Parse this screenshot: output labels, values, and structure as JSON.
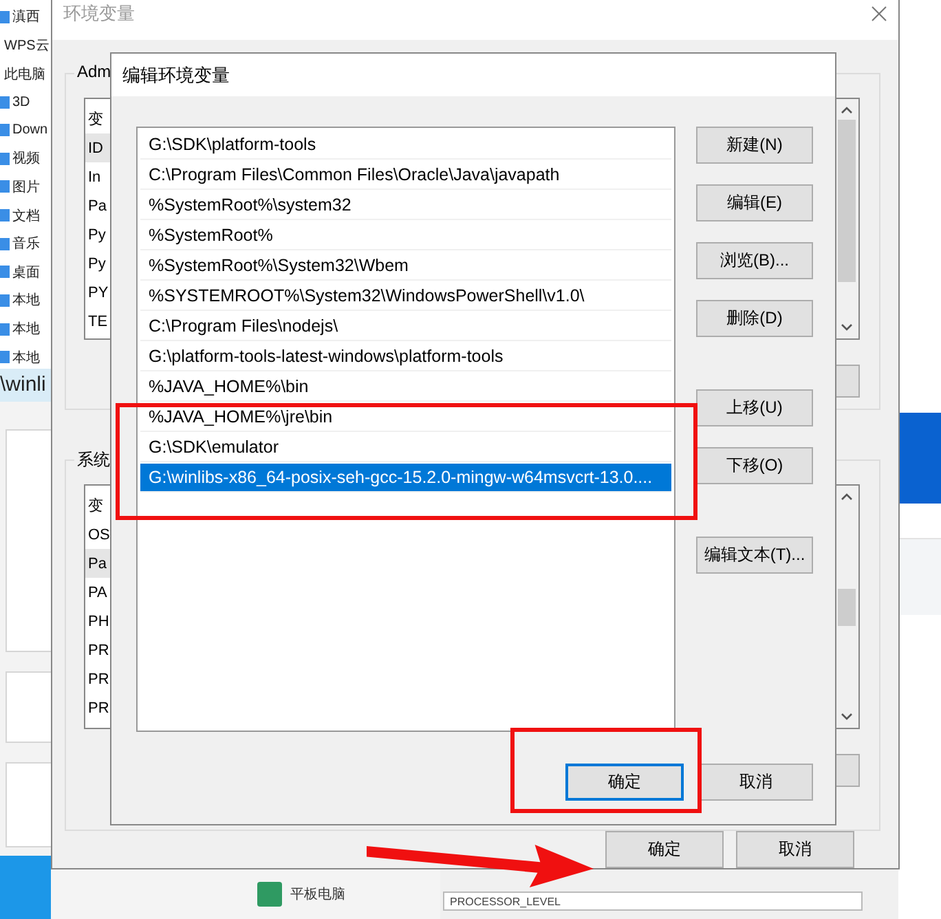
{
  "desktop": {
    "sidebar_items": [
      {
        "label": "滇西",
        "icon": true
      },
      {
        "label": "WPS云",
        "icon": false
      },
      {
        "label": "此电脑",
        "icon": false
      },
      {
        "label": "3D",
        "icon": true
      },
      {
        "label": "Down",
        "icon": true
      },
      {
        "label": "视频",
        "icon": true
      },
      {
        "label": "图片",
        "icon": true
      },
      {
        "label": "文档",
        "icon": true
      },
      {
        "label": "音乐",
        "icon": true
      },
      {
        "label": "桌面",
        "icon": true
      },
      {
        "label": "本地",
        "icon": true
      },
      {
        "label": "本地",
        "icon": true
      },
      {
        "label": "本地",
        "icon": true
      }
    ],
    "path_text": "\\winli",
    "taskbar_label": "平板电脑",
    "field_value": "PROCESSOR_LEVEL"
  },
  "env_dialog": {
    "title": "环境变量",
    "user_group": {
      "title": "Adm",
      "header": "变",
      "rows": [
        {
          "name": "ID",
          "selected": true
        },
        {
          "name": "In",
          "selected": false
        },
        {
          "name": "Pa",
          "selected": false
        },
        {
          "name": "Py",
          "selected": false
        },
        {
          "name": "Py",
          "selected": false
        },
        {
          "name": "PY",
          "selected": false
        },
        {
          "name": "TE",
          "selected": false
        }
      ]
    },
    "system_group": {
      "title": "系统",
      "header": "变",
      "rows": [
        {
          "name": "OS",
          "selected": false
        },
        {
          "name": "Pa",
          "selected": true
        },
        {
          "name": "PA",
          "selected": false
        },
        {
          "name": "PH",
          "selected": false
        },
        {
          "name": "PR",
          "selected": false
        },
        {
          "name": "PR",
          "selected": false
        },
        {
          "name": "PR",
          "selected": false
        }
      ]
    },
    "buttons": [
      {
        "label": "确定"
      },
      {
        "label": "取消"
      }
    ]
  },
  "edit_dialog": {
    "title": "编辑环境变量",
    "entries": [
      {
        "text": "G:\\SDK\\platform-tools",
        "selected": false
      },
      {
        "text": "C:\\Program Files\\Common Files\\Oracle\\Java\\javapath",
        "selected": false
      },
      {
        "text": "%SystemRoot%\\system32",
        "selected": false
      },
      {
        "text": "%SystemRoot%",
        "selected": false
      },
      {
        "text": "%SystemRoot%\\System32\\Wbem",
        "selected": false
      },
      {
        "text": "%SYSTEMROOT%\\System32\\WindowsPowerShell\\v1.0\\",
        "selected": false
      },
      {
        "text": "C:\\Program Files\\nodejs\\",
        "selected": false
      },
      {
        "text": "G:\\platform-tools-latest-windows\\platform-tools",
        "selected": false
      },
      {
        "text": "%JAVA_HOME%\\bin",
        "selected": false
      },
      {
        "text": "%JAVA_HOME%\\jre\\bin",
        "selected": false
      },
      {
        "text": "G:\\SDK\\emulator",
        "selected": false
      },
      {
        "text": "G:\\winlibs-x86_64-posix-seh-gcc-15.2.0-mingw-w64msvcrt-13.0....",
        "selected": true
      }
    ],
    "side_button_groups": [
      {
        "buttons": [
          {
            "label": "新建(N)"
          },
          {
            "label": "编辑(E)"
          },
          {
            "label": "浏览(B)..."
          },
          {
            "label": "删除(D)"
          }
        ]
      },
      {
        "buttons": [
          {
            "label": "上移(U)"
          },
          {
            "label": "下移(O)"
          }
        ]
      },
      {
        "buttons": [
          {
            "label": "编辑文本(T)..."
          }
        ]
      }
    ],
    "footer_buttons": [
      {
        "label": "确定",
        "default": true
      },
      {
        "label": "取消",
        "default": false
      }
    ]
  }
}
